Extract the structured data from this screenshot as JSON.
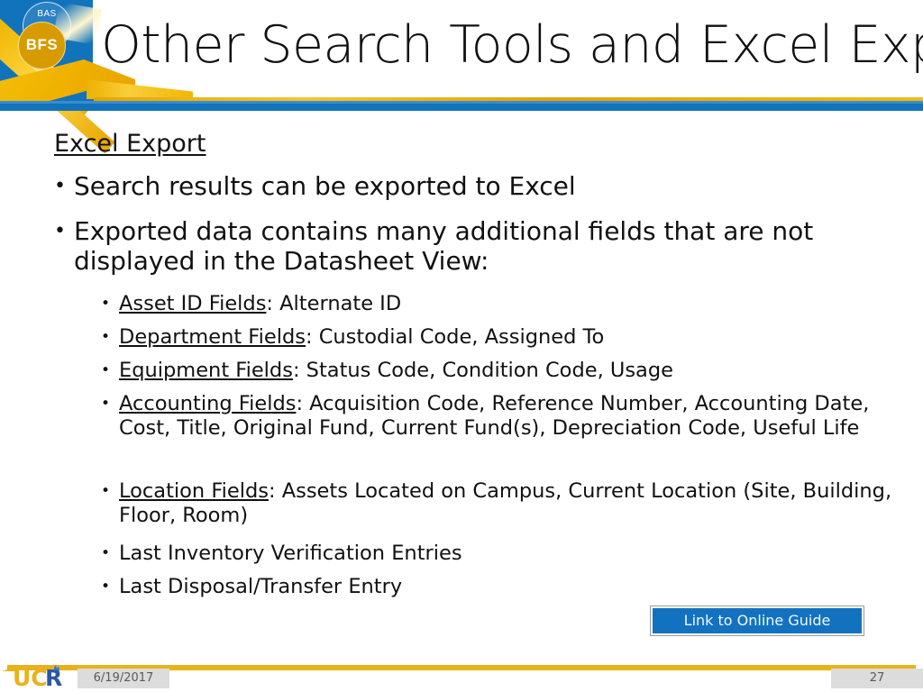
{
  "header": {
    "title": "Other Search Tools and Excel Export",
    "logo": {
      "outer_label": "BAS",
      "inner_label": "BFS"
    },
    "accent_blue": "#1273BD",
    "accent_gold": "#E8A400"
  },
  "body": {
    "heading": "Excel Export",
    "bullets": [
      {
        "bullet": "•",
        "text": "Search results can be exported to Excel"
      },
      {
        "bullet": "•",
        "text": "Exported data contains many additional fields that are not displayed in the Datasheet View:"
      }
    ],
    "subbullets": [
      {
        "bullet": "•",
        "label": "Asset ID Fields",
        "rest": ": Alternate ID"
      },
      {
        "bullet": "•",
        "label": "Department Fields",
        "rest": ": Custodial Code, Assigned To"
      },
      {
        "bullet": "•",
        "label": "Equipment Fields",
        "rest": ": Status Code, Condition Code, Usage"
      },
      {
        "bullet": "•",
        "label": "Accounting Fields",
        "rest": ": Acquisition Code, Reference Number, Accounting Date, Cost, Title, Original Fund, Current Fund(s), Depreciation Code, Useful Life"
      },
      {
        "bullet": "•",
        "label": "Location Fields",
        "rest": ": Assets Located on Campus, Current Location (Site, Building, Floor, Room)"
      },
      {
        "bullet": "•",
        "label": "",
        "rest": "Last Inventory Verification Entries"
      },
      {
        "bullet": "•",
        "label": "",
        "rest": "Last Disposal/Transfer Entry"
      }
    ]
  },
  "link_button": {
    "label": "Link to Online Guide",
    "color": "#1272BF"
  },
  "footer": {
    "brand": "UCR",
    "brand_uc": "UC",
    "brand_r": "R",
    "date": "6/19/2017",
    "page_number": "27",
    "rule_color": "#E8B21B"
  }
}
